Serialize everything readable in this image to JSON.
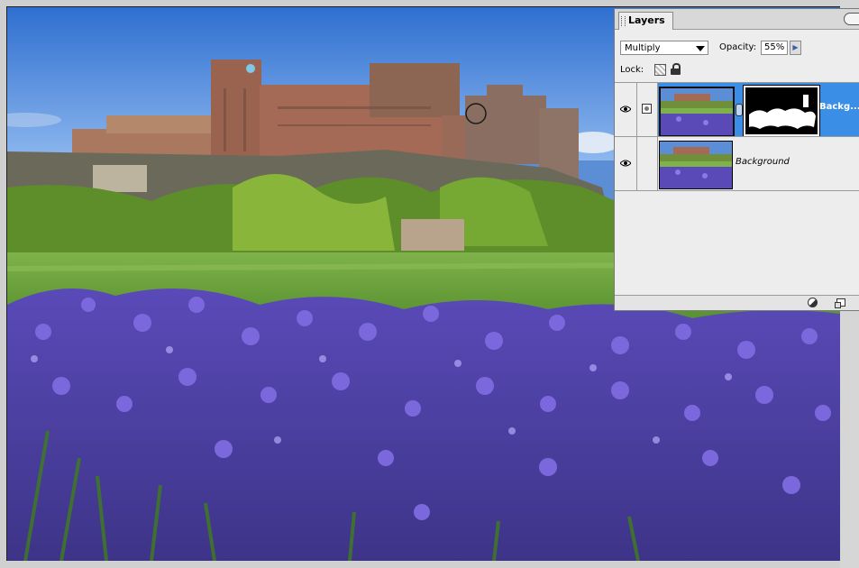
{
  "layers_panel": {
    "tab_title": "Layers",
    "menu_button": "",
    "blend_mode": "Multiply",
    "opacity_label": "Opacity:",
    "opacity_value": "55%",
    "opacity_arrow": "▶",
    "lock_label": "Lock:",
    "layers": [
      {
        "name": "Backg...",
        "visible": true,
        "selected": true,
        "has_mask": true
      },
      {
        "name": "Background",
        "visible": true,
        "selected": false,
        "has_mask": false
      }
    ]
  },
  "colors": {
    "selection": "#3a8ee6",
    "panel_bg": "#ededed",
    "sky": "#5c8ed6",
    "grass": "#6fa63a",
    "bluebells": "#6a57c9"
  },
  "icons": [
    "eye-icon",
    "layer-mask-icon",
    "link-icon",
    "lock-transparent-icon",
    "lock-icon",
    "adjustment-layer-icon",
    "new-layer-icon",
    "panel-menu-icon",
    "grip-icon"
  ]
}
